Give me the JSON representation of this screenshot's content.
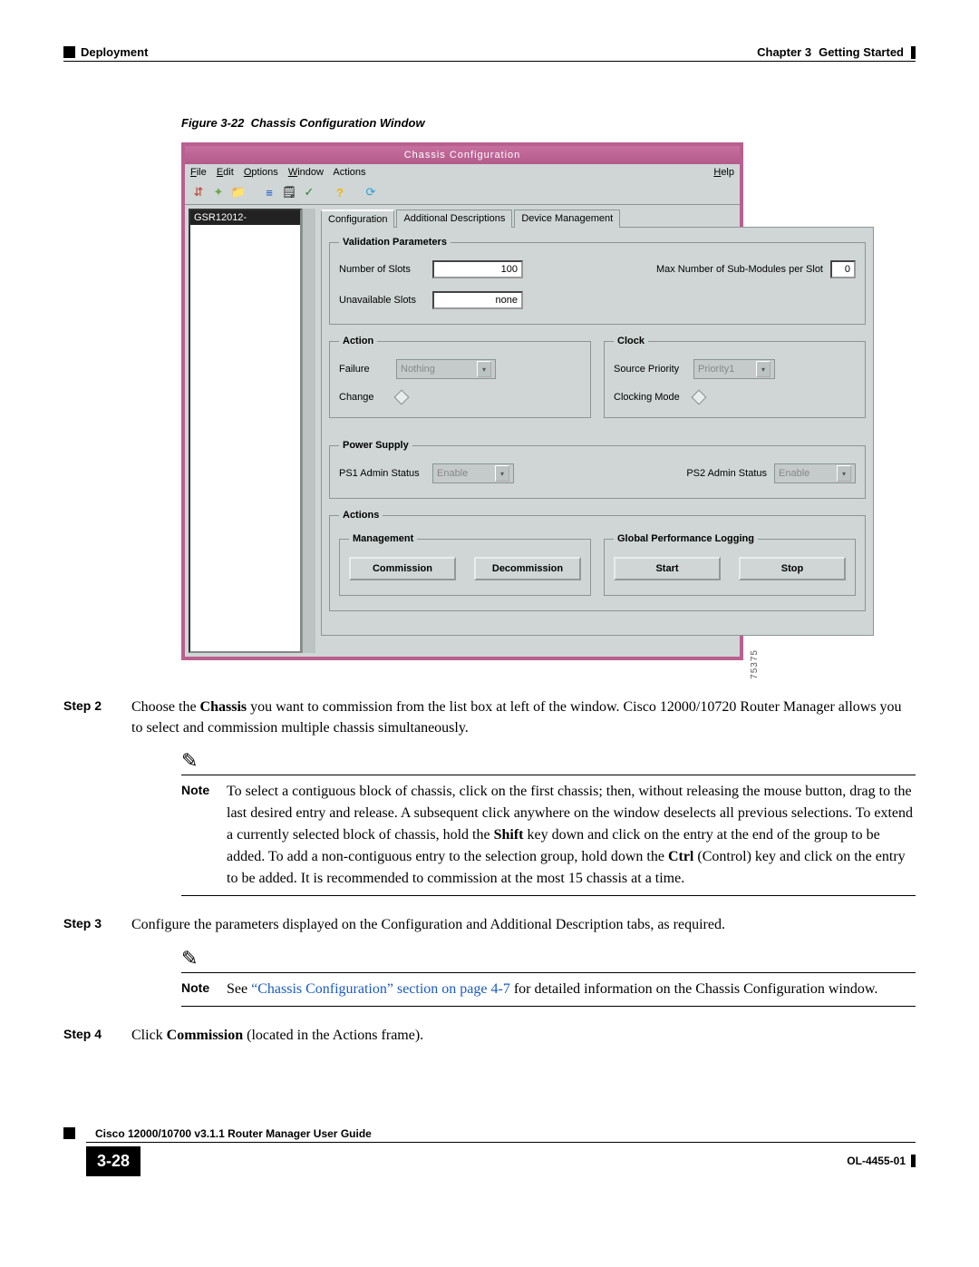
{
  "header": {
    "left": "Deployment",
    "chapter": "Chapter 3",
    "title": "Getting Started"
  },
  "figure": {
    "label": "Figure 3-22",
    "title": "Chassis Configuration Window"
  },
  "window": {
    "title": "Chassis Configuration",
    "menu": {
      "file": "File",
      "edit": "Edit",
      "options": "Options",
      "window": "Window",
      "actions": "Actions",
      "help": "Help"
    },
    "list": {
      "item0": "GSR12012-"
    },
    "tabs": {
      "config": "Configuration",
      "addl": "Additional Descriptions",
      "devmgmt": "Device Management"
    },
    "validation": {
      "legend": "Validation Parameters",
      "num_slots_label": "Number of Slots",
      "num_slots_value": "100",
      "max_sub_label": "Max Number of Sub-Modules per Slot",
      "max_sub_value": "0",
      "unavail_label": "Unavailable Slots",
      "unavail_value": "none"
    },
    "action": {
      "legend": "Action",
      "failure_label": "Failure",
      "failure_value": "Nothing",
      "change_label": "Change"
    },
    "clock": {
      "legend": "Clock",
      "src_label": "Source Priority",
      "src_value": "Priority1",
      "mode_label": "Clocking Mode"
    },
    "power": {
      "legend": "Power Supply",
      "ps1_label": "PS1 Admin Status",
      "ps1_value": "Enable",
      "ps2_label": "PS2 Admin Status",
      "ps2_value": "Enable"
    },
    "actions": {
      "legend": "Actions",
      "mgmt_legend": "Management",
      "btn_commission": "Commission",
      "btn_decommission": "Decommission",
      "gpl_legend": "Global Performance Logging",
      "btn_start": "Start",
      "btn_stop": "Stop"
    },
    "side_num": "75375"
  },
  "steps": {
    "s2_label": "Step 2",
    "s2_body_pre": "Choose the ",
    "s2_body_bold": "Chassis",
    "s2_body_post": " you want to commission from the list box at left of the window. Cisco 12000/10720 Router Manager allows you to select and commission multiple chassis simultaneously.",
    "note1_label": "Note",
    "note1_a": "To select a contiguous block of chassis, click on the first chassis; then, without releasing the mouse button, drag to the last desired entry and release. A subsequent click anywhere on the window deselects all previous selections. To extend a currently selected block of chassis, hold the ",
    "note1_shift": "Shift",
    "note1_b": " key down and click on the entry at the end of the group to be added. To add a non-contiguous entry to the selection group, hold down the ",
    "note1_ctrl": "Ctrl",
    "note1_c": " (Control) key and click on the entry to be added. It is recommended to commission at the most 15 chassis at a time.",
    "s3_label": "Step 3",
    "s3_body": "Configure the parameters displayed on the Configuration and Additional Description tabs, as required.",
    "note2_label": "Note",
    "note2_a": "See ",
    "note2_link": "“Chassis Configuration” section on page 4-7",
    "note2_b": " for detailed information on the Chassis Configuration window.",
    "s4_label": "Step 4",
    "s4_a": "Click ",
    "s4_bold": "Commission",
    "s4_b": " (located in the Actions frame)."
  },
  "footer": {
    "guide": "Cisco 12000/10700 v3.1.1 Router Manager User Guide",
    "page": "3-28",
    "docid": "OL-4455-01"
  }
}
